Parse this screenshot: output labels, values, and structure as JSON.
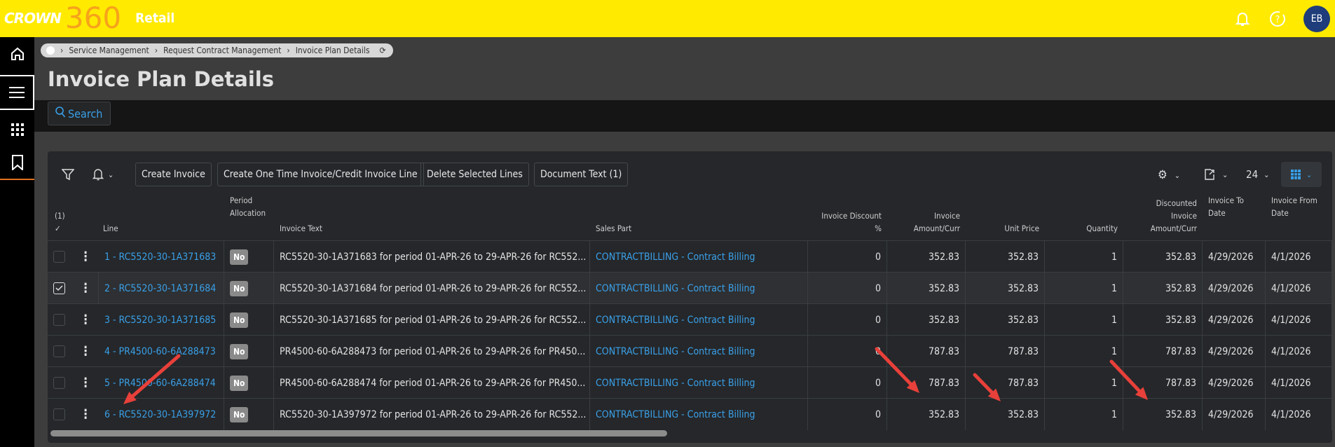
{
  "app": {
    "brand": "CROWN",
    "product": "360",
    "edition": "Retail",
    "user_initials": "EB"
  },
  "breadcrumb": [
    "Service Management",
    "Request Contract Management",
    "Invoice Plan Details"
  ],
  "page_title": "Invoice Plan Details",
  "search_label": "Search",
  "toolbar": {
    "create_invoice": "Create Invoice",
    "create_one_time": "Create One Time Invoice/Credit Invoice Line",
    "delete_selected": "Delete Selected Lines",
    "document_text": "Document Text (1)",
    "page_size": "24"
  },
  "columns": {
    "selected_count": "(1)",
    "line": "Line",
    "period_allocation": [
      "Period",
      "Allocation"
    ],
    "invoice_text": "Invoice Text",
    "sales_part": "Sales Part",
    "invoice_discount": [
      "Invoice Discount",
      "%"
    ],
    "invoice_amount": [
      "Invoice",
      "Amount/Curr"
    ],
    "unit_price": "Unit Price",
    "quantity": "Quantity",
    "discounted": [
      "Discounted",
      "Invoice",
      "Amount/Curr"
    ],
    "invoice_to_date": [
      "Invoice To",
      "Date"
    ],
    "invoice_from_date": [
      "Invoice From",
      "Date"
    ]
  },
  "rows": [
    {
      "line": "1 - RC5520-30-1A371683",
      "period": "No",
      "text": "RC5520-30-1A371683 for period 01-APR-26 to 29-APR-26 for RC552...",
      "sales_part": "CONTRACTBILLING - Contract Billing",
      "discount": "0",
      "amount": "352.83",
      "unit_price": "352.83",
      "quantity": "1",
      "discounted": "352.83",
      "to_date": "4/29/2026",
      "from_date": "4/1/2026",
      "selected": false
    },
    {
      "line": "2 - RC5520-30-1A371684",
      "period": "No",
      "text": "RC5520-30-1A371684 for period 01-APR-26 to 29-APR-26 for RC552...",
      "sales_part": "CONTRACTBILLING - Contract Billing",
      "discount": "0",
      "amount": "352.83",
      "unit_price": "352.83",
      "quantity": "1",
      "discounted": "352.83",
      "to_date": "4/29/2026",
      "from_date": "4/1/2026",
      "selected": true
    },
    {
      "line": "3 - RC5520-30-1A371685",
      "period": "No",
      "text": "RC5520-30-1A371685 for period 01-APR-26 to 29-APR-26 for RC552...",
      "sales_part": "CONTRACTBILLING - Contract Billing",
      "discount": "0",
      "amount": "352.83",
      "unit_price": "352.83",
      "quantity": "1",
      "discounted": "352.83",
      "to_date": "4/29/2026",
      "from_date": "4/1/2026",
      "selected": false
    },
    {
      "line": "4 - PR4500-60-6A288473",
      "period": "No",
      "text": "PR4500-60-6A288473 for period 01-APR-26 to 29-APR-26 for PR450...",
      "sales_part": "CONTRACTBILLING - Contract Billing",
      "discount": "0",
      "amount": "787.83",
      "unit_price": "787.83",
      "quantity": "1",
      "discounted": "787.83",
      "to_date": "4/29/2026",
      "from_date": "4/1/2026",
      "selected": false
    },
    {
      "line": "5 - PR4500-60-6A288474",
      "period": "No",
      "text": "PR4500-60-6A288474 for period 01-APR-26 to 29-APR-26 for PR450...",
      "sales_part": "CONTRACTBILLING - Contract Billing",
      "discount": "0",
      "amount": "787.83",
      "unit_price": "787.83",
      "quantity": "1",
      "discounted": "787.83",
      "to_date": "4/29/2026",
      "from_date": "4/1/2026",
      "selected": false
    },
    {
      "line": "6 - RC5520-30-1A397972",
      "period": "No",
      "text": "RC5520-30-1A397972 for period 01-APR-26 to 29-APR-26 for RC552...",
      "sales_part": "CONTRACTBILLING - Contract Billing",
      "discount": "0",
      "amount": "352.83",
      "unit_price": "352.83",
      "quantity": "1",
      "discounted": "352.83",
      "to_date": "4/29/2026",
      "from_date": "4/1/2026",
      "selected": false
    }
  ],
  "colors": {
    "brand_yellow": "#ffea00",
    "link": "#3aa0e8",
    "annotation_arrow": "#e8403a"
  }
}
